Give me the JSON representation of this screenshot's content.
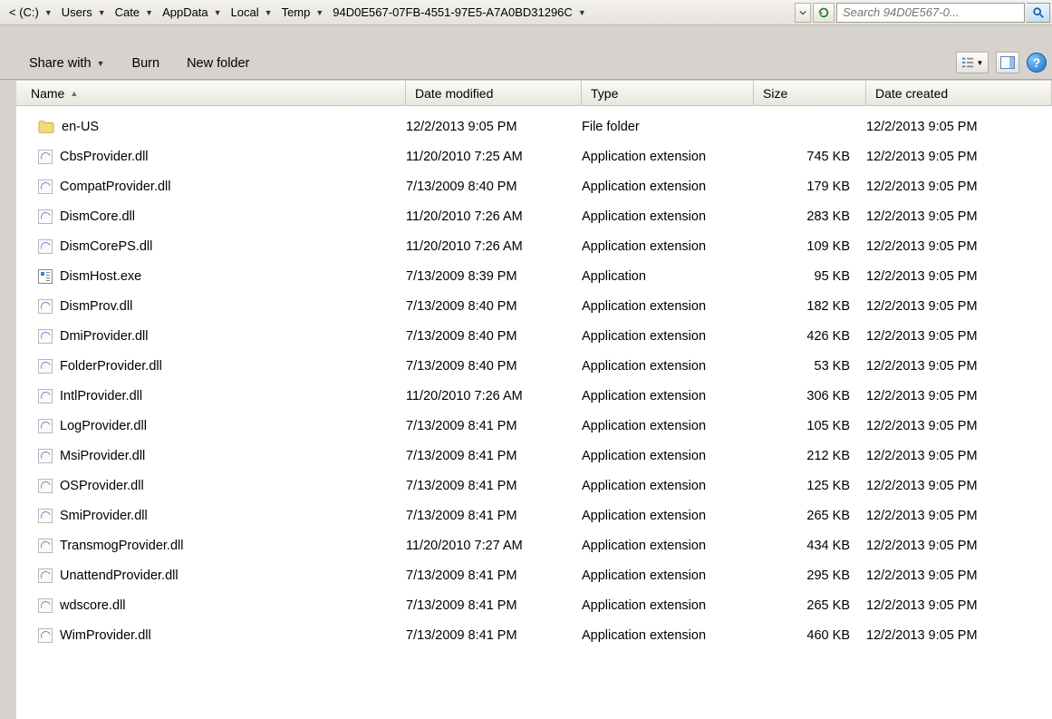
{
  "breadcrumbs": [
    {
      "label": "< (C:)"
    },
    {
      "label": "Users"
    },
    {
      "label": "Cate"
    },
    {
      "label": "AppData"
    },
    {
      "label": "Local"
    },
    {
      "label": "Temp"
    },
    {
      "label": "94D0E567-07FB-4551-97E5-A7A0BD31296C"
    }
  ],
  "search": {
    "placeholder": "Search 94D0E567-0..."
  },
  "toolbar": {
    "share": "Share with",
    "burn": "Burn",
    "newfolder": "New folder"
  },
  "columns": {
    "name": "Name",
    "date": "Date modified",
    "type": "Type",
    "size": "Size",
    "created": "Date created"
  },
  "files": [
    {
      "icon": "folder",
      "name": "en-US",
      "date": "12/2/2013 9:05 PM",
      "type": "File folder",
      "size": "",
      "created": "12/2/2013 9:05 PM"
    },
    {
      "icon": "dll",
      "name": "CbsProvider.dll",
      "date": "11/20/2010 7:25 AM",
      "type": "Application extension",
      "size": "745 KB",
      "created": "12/2/2013 9:05 PM"
    },
    {
      "icon": "dll",
      "name": "CompatProvider.dll",
      "date": "7/13/2009 8:40 PM",
      "type": "Application extension",
      "size": "179 KB",
      "created": "12/2/2013 9:05 PM"
    },
    {
      "icon": "dll",
      "name": "DismCore.dll",
      "date": "11/20/2010 7:26 AM",
      "type": "Application extension",
      "size": "283 KB",
      "created": "12/2/2013 9:05 PM"
    },
    {
      "icon": "dll",
      "name": "DismCorePS.dll",
      "date": "11/20/2010 7:26 AM",
      "type": "Application extension",
      "size": "109 KB",
      "created": "12/2/2013 9:05 PM"
    },
    {
      "icon": "exe",
      "name": "DismHost.exe",
      "date": "7/13/2009 8:39 PM",
      "type": "Application",
      "size": "95 KB",
      "created": "12/2/2013 9:05 PM"
    },
    {
      "icon": "dll",
      "name": "DismProv.dll",
      "date": "7/13/2009 8:40 PM",
      "type": "Application extension",
      "size": "182 KB",
      "created": "12/2/2013 9:05 PM"
    },
    {
      "icon": "dll",
      "name": "DmiProvider.dll",
      "date": "7/13/2009 8:40 PM",
      "type": "Application extension",
      "size": "426 KB",
      "created": "12/2/2013 9:05 PM"
    },
    {
      "icon": "dll",
      "name": "FolderProvider.dll",
      "date": "7/13/2009 8:40 PM",
      "type": "Application extension",
      "size": "53 KB",
      "created": "12/2/2013 9:05 PM"
    },
    {
      "icon": "dll",
      "name": "IntlProvider.dll",
      "date": "11/20/2010 7:26 AM",
      "type": "Application extension",
      "size": "306 KB",
      "created": "12/2/2013 9:05 PM"
    },
    {
      "icon": "dll",
      "name": "LogProvider.dll",
      "date": "7/13/2009 8:41 PM",
      "type": "Application extension",
      "size": "105 KB",
      "created": "12/2/2013 9:05 PM"
    },
    {
      "icon": "dll",
      "name": "MsiProvider.dll",
      "date": "7/13/2009 8:41 PM",
      "type": "Application extension",
      "size": "212 KB",
      "created": "12/2/2013 9:05 PM"
    },
    {
      "icon": "dll",
      "name": "OSProvider.dll",
      "date": "7/13/2009 8:41 PM",
      "type": "Application extension",
      "size": "125 KB",
      "created": "12/2/2013 9:05 PM"
    },
    {
      "icon": "dll",
      "name": "SmiProvider.dll",
      "date": "7/13/2009 8:41 PM",
      "type": "Application extension",
      "size": "265 KB",
      "created": "12/2/2013 9:05 PM"
    },
    {
      "icon": "dll",
      "name": "TransmogProvider.dll",
      "date": "11/20/2010 7:27 AM",
      "type": "Application extension",
      "size": "434 KB",
      "created": "12/2/2013 9:05 PM"
    },
    {
      "icon": "dll",
      "name": "UnattendProvider.dll",
      "date": "7/13/2009 8:41 PM",
      "type": "Application extension",
      "size": "295 KB",
      "created": "12/2/2013 9:05 PM"
    },
    {
      "icon": "dll",
      "name": "wdscore.dll",
      "date": "7/13/2009 8:41 PM",
      "type": "Application extension",
      "size": "265 KB",
      "created": "12/2/2013 9:05 PM"
    },
    {
      "icon": "dll",
      "name": "WimProvider.dll",
      "date": "7/13/2009 8:41 PM",
      "type": "Application extension",
      "size": "460 KB",
      "created": "12/2/2013 9:05 PM"
    }
  ]
}
